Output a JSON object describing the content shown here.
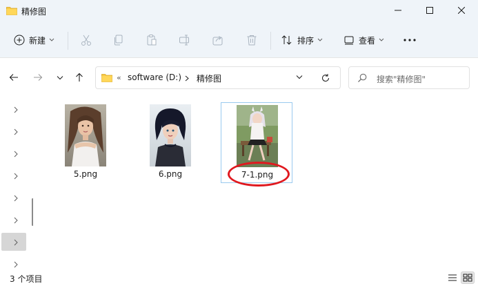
{
  "window": {
    "title": "精修图",
    "controls": {
      "minimize": "minimize-icon",
      "maximize": "maximize-icon",
      "close": "close-icon"
    }
  },
  "toolbar": {
    "new_label": "新建",
    "sort_label": "排序",
    "view_label": "查看",
    "icons": [
      "cut-icon",
      "copy-icon",
      "paste-icon",
      "rename-icon",
      "share-icon",
      "delete-icon",
      "more-icon"
    ]
  },
  "address": {
    "overflow": "«",
    "segments": [
      "software (D:)",
      "精修图"
    ],
    "search_placeholder": "搜索\"精修图\""
  },
  "files": [
    {
      "name": "5.png",
      "selected": false
    },
    {
      "name": "6.png",
      "selected": false
    },
    {
      "name": "7-1.png",
      "selected": true,
      "highlight_color": "#e0191f"
    }
  ],
  "status": {
    "item_count": "3 个项目"
  },
  "colors": {
    "accent_folder": "#f7c948",
    "selection_border": "#99c9ef",
    "annotation_red": "#e0191f"
  }
}
